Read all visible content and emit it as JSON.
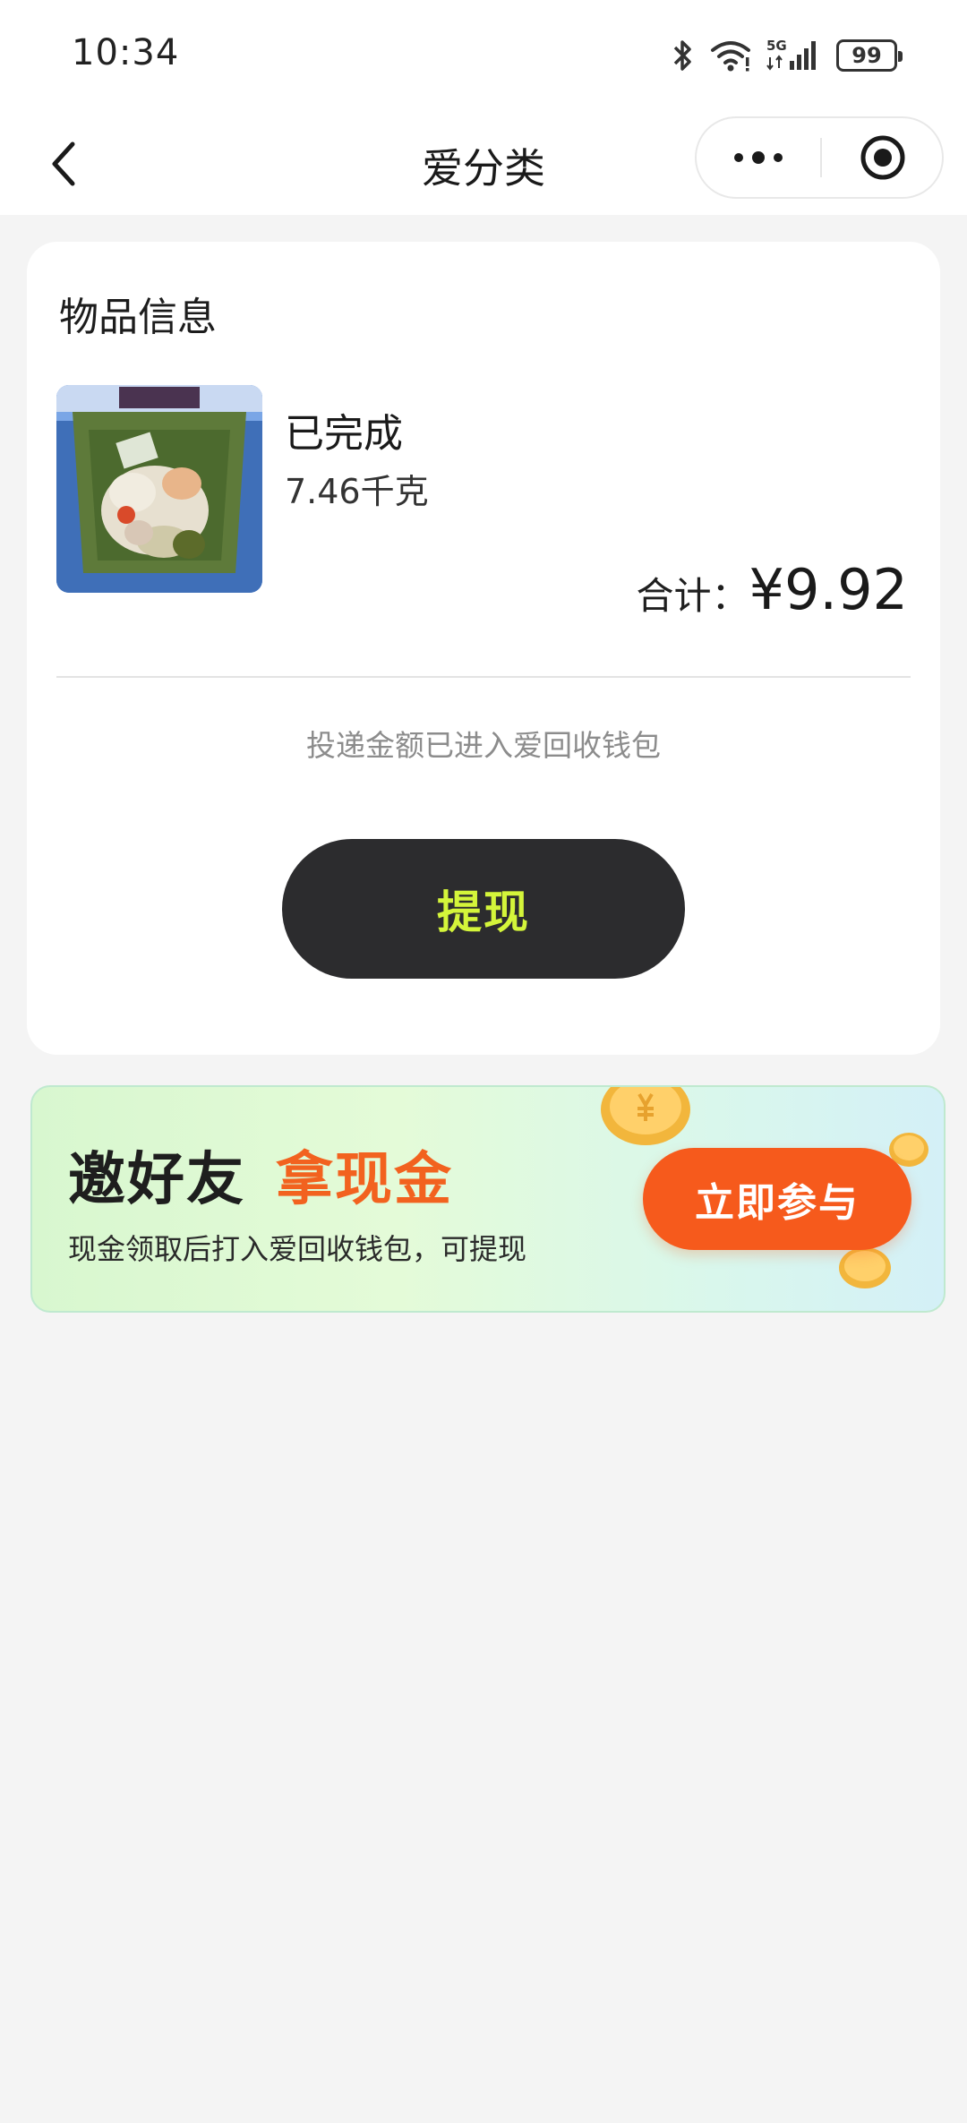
{
  "status_bar": {
    "time": "10:34",
    "network": "5G",
    "battery": "99",
    "icons": [
      "bluetooth-icon",
      "wifi-icon",
      "signal-icon",
      "battery-icon"
    ]
  },
  "nav": {
    "title": "爱分类",
    "icons": [
      "chevron-left-icon",
      "more-icon",
      "close-target-icon"
    ]
  },
  "item_card": {
    "section_title": "物品信息",
    "status": "已完成",
    "weight": "7.46千克",
    "total_label": "合计：",
    "total_value": "¥9.92",
    "wallet_note": "投递金额已进入爱回收钱包",
    "withdraw_label": "提现",
    "withdraw_color": "#d4f53a"
  },
  "promo": {
    "title_part1": "邀好友",
    "title_part2": "拿现金",
    "subtitle": "现金领取后打入爱回收钱包，可提现",
    "button_label": "立即参与",
    "accent_color": "#f65a1c"
  }
}
